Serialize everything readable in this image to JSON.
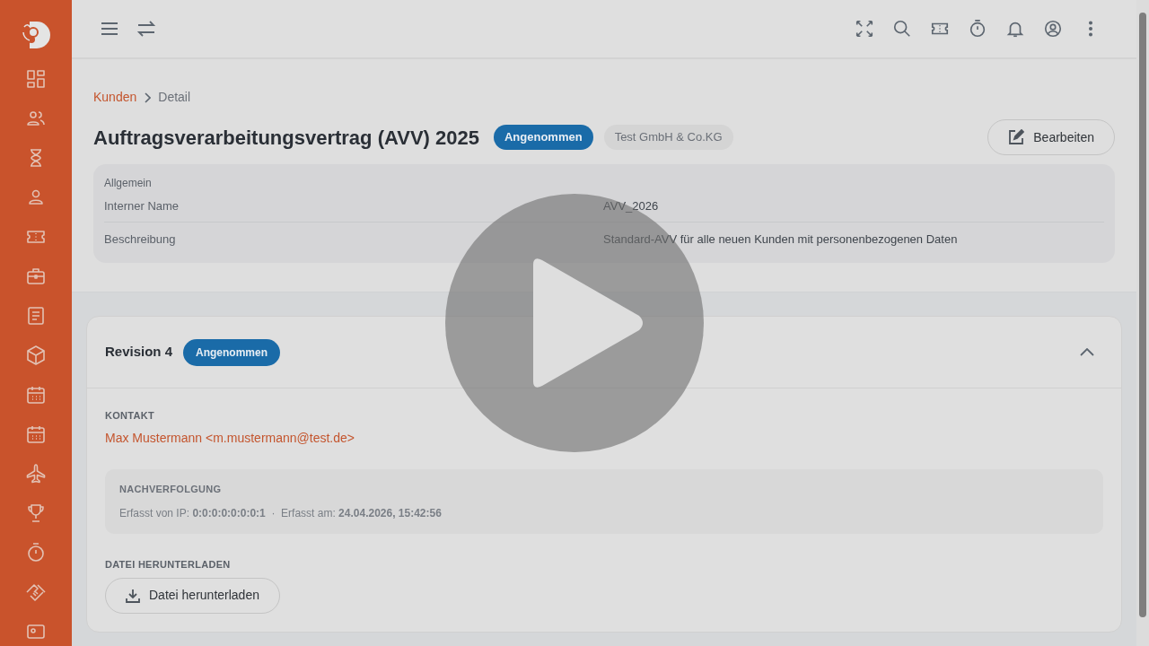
{
  "breadcrumb": [
    {
      "label": "Kunden",
      "kind": "link"
    },
    {
      "label": "Detail",
      "kind": "current"
    }
  ],
  "title": "Auftragsverarbeitungsvertrag (AVV) 2025",
  "status_badge": "Angenommen",
  "customer_tag": "Test GmbH & Co.KG",
  "edit_button": "Bearbeiten",
  "general": {
    "heading": "Allgemein",
    "rows": [
      {
        "label": "Interner Name",
        "value": "AVV_2026"
      },
      {
        "label": "Beschreibung",
        "value": "Standard-AVV für alle neuen Kunden mit personenbezogenen Daten"
      }
    ]
  },
  "revision": {
    "title": "Revision 4",
    "badge": "Angenommen",
    "expanded": true,
    "contact_label": "KONTAKT",
    "contact": "Max Mustermann <m.mustermann@test.de>",
    "tracking_heading": "NACHVERFOLGUNG",
    "tracking_text": "Erfasst von IP: **0:0:0:0:0:0:0:1**  ·  Erfasst am: **24.04.2026, 15:42:56**",
    "download_label": "DATEI HERUNTERLADEN",
    "download_button": "Datei herunterladen"
  }
}
